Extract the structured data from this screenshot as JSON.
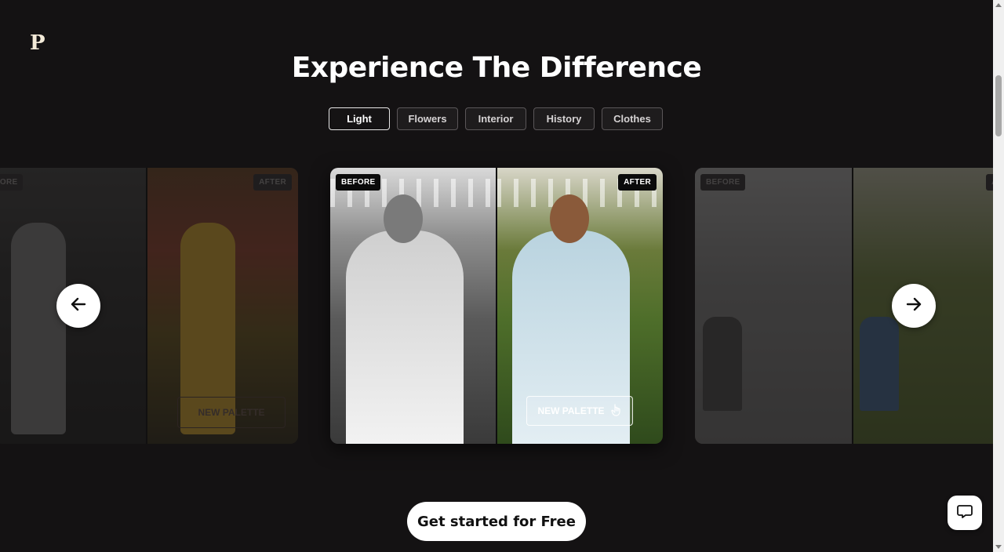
{
  "brand": {
    "logo": "P"
  },
  "hero": {
    "title": "Experience The Difference"
  },
  "tabs": [
    {
      "label": "Light",
      "active": true
    },
    {
      "label": "Flowers",
      "active": false
    },
    {
      "label": "Interior",
      "active": false
    },
    {
      "label": "History",
      "active": false
    },
    {
      "label": "Clothes",
      "active": false
    }
  ],
  "carousel": {
    "left": {
      "before": "BEFORE",
      "after": "AFTER",
      "button": "NEW PALETTE"
    },
    "center": {
      "before": "BEFORE",
      "after": "AFTER",
      "button": "NEW PALETTE"
    },
    "right": {
      "before": "BEFORE",
      "after": "AFTER"
    }
  },
  "cta": {
    "label": "Get started for Free"
  },
  "icons": {
    "prev": "arrow-left-icon",
    "next": "arrow-right-icon",
    "chat": "chat-bubble-icon",
    "hand": "hand-pointer-icon"
  }
}
